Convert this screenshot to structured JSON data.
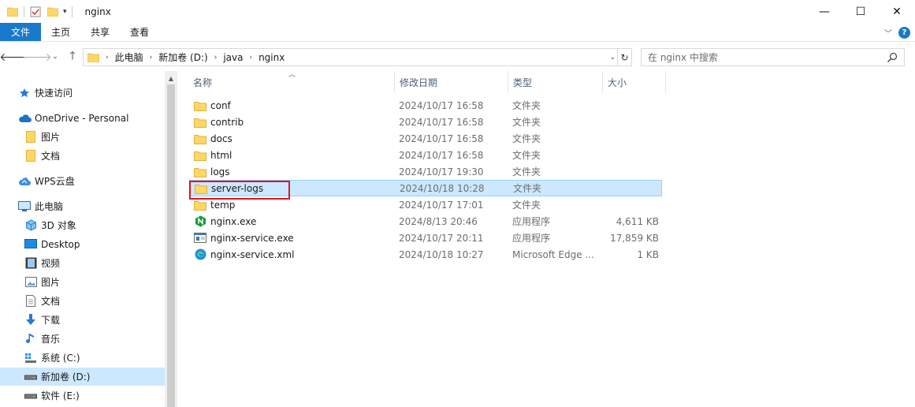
{
  "window": {
    "title": "nginx",
    "controls": [
      "—",
      "☐",
      "✕"
    ]
  },
  "ribbon": {
    "tabs": [
      "文件",
      "主页",
      "共享",
      "查看"
    ],
    "help": "?"
  },
  "address": {
    "crumbs": [
      "此电脑",
      "新加卷 (D:)",
      "java",
      "nginx"
    ]
  },
  "search": {
    "placeholder": "在 nginx 中搜索"
  },
  "sidebar": {
    "items": [
      {
        "label": "快速访问",
        "icon": "star-icon"
      },
      {
        "label": "OneDrive - Personal",
        "icon": "cloud-icon"
      },
      {
        "label": "图片",
        "icon": "folder-icon"
      },
      {
        "label": "文档",
        "icon": "folder-icon"
      },
      {
        "label": "WPS云盘",
        "icon": "wps-cloud-icon"
      },
      {
        "label": "此电脑",
        "icon": "computer-icon"
      },
      {
        "label": "3D 对象",
        "icon": "cube-icon"
      },
      {
        "label": "Desktop",
        "icon": "desktop-icon"
      },
      {
        "label": "视频",
        "icon": "film-icon"
      },
      {
        "label": "图片",
        "icon": "picture-icon"
      },
      {
        "label": "文档",
        "icon": "document-icon"
      },
      {
        "label": "下载",
        "icon": "download-icon"
      },
      {
        "label": "音乐",
        "icon": "music-icon"
      },
      {
        "label": "系统 (C:)",
        "icon": "system-drive-icon"
      },
      {
        "label": "新加卷 (D:)",
        "icon": "drive-icon"
      },
      {
        "label": "软件 (E:)",
        "icon": "drive-icon"
      }
    ]
  },
  "columns": {
    "name": "名称",
    "modified": "修改日期",
    "type": "类型",
    "size": "大小"
  },
  "files": [
    {
      "name": "conf",
      "modified": "2024/10/17 16:58",
      "type": "文件夹",
      "size": "",
      "icon": "folder-icon"
    },
    {
      "name": "contrib",
      "modified": "2024/10/17 16:58",
      "type": "文件夹",
      "size": "",
      "icon": "folder-icon"
    },
    {
      "name": "docs",
      "modified": "2024/10/17 16:58",
      "type": "文件夹",
      "size": "",
      "icon": "folder-icon"
    },
    {
      "name": "html",
      "modified": "2024/10/17 16:58",
      "type": "文件夹",
      "size": "",
      "icon": "folder-icon"
    },
    {
      "name": "logs",
      "modified": "2024/10/17 19:30",
      "type": "文件夹",
      "size": "",
      "icon": "folder-icon"
    },
    {
      "name": "server-logs",
      "modified": "2024/10/18 10:28",
      "type": "文件夹",
      "size": "",
      "icon": "folder-icon"
    },
    {
      "name": "temp",
      "modified": "2024/10/17 17:01",
      "type": "文件夹",
      "size": "",
      "icon": "folder-icon"
    },
    {
      "name": "nginx.exe",
      "modified": "2024/8/13 20:46",
      "type": "应用程序",
      "size": "4,611 KB",
      "icon": "nginx-exe-icon"
    },
    {
      "name": "nginx-service.exe",
      "modified": "2024/10/17 20:11",
      "type": "应用程序",
      "size": "17,859 KB",
      "icon": "service-exe-icon"
    },
    {
      "name": "nginx-service.xml",
      "modified": "2024/10/18 10:27",
      "type": "Microsoft Edge ...",
      "size": "1 KB",
      "icon": "edge-icon"
    }
  ],
  "selected_file": "server-logs",
  "colors": {
    "accent": "#1979ca",
    "selection": "#cce8ff",
    "highlight_box": "#e0141e",
    "folder": "#ffd764"
  }
}
